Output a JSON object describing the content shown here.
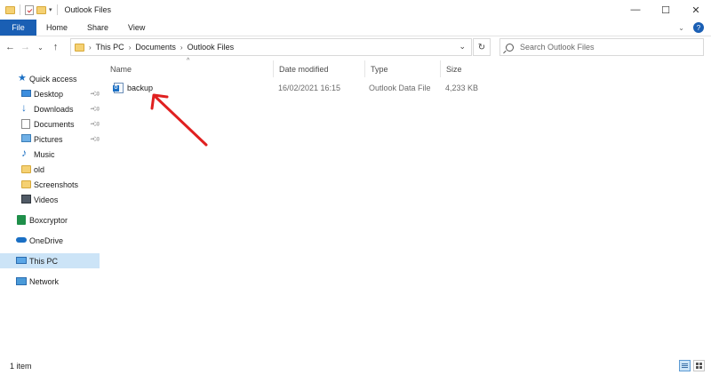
{
  "window": {
    "title": "Outlook Files",
    "quick_access_down": "▾",
    "buttons": {
      "minimize": "—",
      "maximize": "☐",
      "close": "✕"
    }
  },
  "ribbon": {
    "tabs": [
      "File",
      "Home",
      "Share",
      "View"
    ],
    "expand_icon": "chevron-down-icon",
    "help_icon": "help-icon"
  },
  "address_bar": {
    "breadcrumbs": [
      "This PC",
      "Documents",
      "Outlook Files"
    ],
    "nav": {
      "back": "←",
      "forward": "→",
      "recent": "⌄",
      "up": "↑"
    },
    "refresh": "↻"
  },
  "search": {
    "placeholder": "Search Outlook Files"
  },
  "sidebar": {
    "items": [
      {
        "label": "Quick access",
        "icon": "star-icon",
        "pinned": false
      },
      {
        "label": "Desktop",
        "icon": "desktop-icon",
        "pinned": true
      },
      {
        "label": "Downloads",
        "icon": "download-icon",
        "pinned": true
      },
      {
        "label": "Documents",
        "icon": "documents-icon",
        "pinned": true
      },
      {
        "label": "Pictures",
        "icon": "pictures-icon",
        "pinned": true
      },
      {
        "label": "Music",
        "icon": "music-icon",
        "pinned": false
      },
      {
        "label": "old",
        "icon": "folder-icon",
        "pinned": false
      },
      {
        "label": "Screenshots",
        "icon": "folder-icon",
        "pinned": false
      },
      {
        "label": "Videos",
        "icon": "videos-icon",
        "pinned": false
      },
      {
        "label": "Boxcryptor",
        "icon": "boxcryptor-icon",
        "pinned": false
      },
      {
        "label": "OneDrive",
        "icon": "cloud-icon",
        "pinned": false
      },
      {
        "label": "This PC",
        "icon": "computer-icon",
        "pinned": false,
        "selected": true
      },
      {
        "label": "Network",
        "icon": "network-icon",
        "pinned": false
      }
    ]
  },
  "file_list": {
    "columns": [
      "Name",
      "Date modified",
      "Type",
      "Size"
    ],
    "rows": [
      {
        "name": "backup",
        "date_modified": "16/02/2021 16:15",
        "type": "Outlook Data File",
        "size": "4,233 KB"
      }
    ]
  },
  "status_bar": {
    "item_count": "1 item"
  },
  "colors": {
    "accent": "#1a5fb4",
    "selection": "#cce4f7",
    "annotation": "#e02020",
    "folder": "#f5d173"
  }
}
